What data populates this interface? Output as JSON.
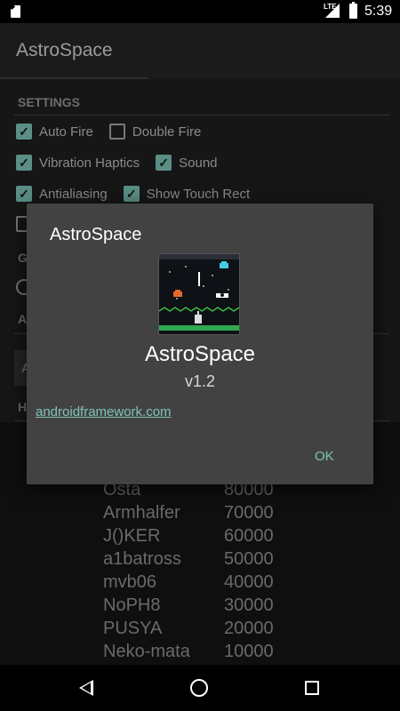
{
  "status_bar": {
    "time": "5:39",
    "network": "LTE"
  },
  "app_bar": {
    "title": "AstroSpace"
  },
  "settings": {
    "header": "SETTINGS",
    "checkboxes": [
      {
        "label": "Auto Fire",
        "checked": true
      },
      {
        "label": "Double Fire",
        "checked": false
      },
      {
        "label": "Vibration Haptics",
        "checked": true
      },
      {
        "label": "Sound",
        "checked": true
      },
      {
        "label": "Antialiasing",
        "checked": true
      },
      {
        "label": "Show Touch Rect",
        "checked": true
      }
    ],
    "partial_headers": [
      "G",
      "A",
      "H"
    ],
    "partial_input": "A"
  },
  "highscores": [
    {
      "name": "Osta",
      "score": "80000"
    },
    {
      "name": "Armhalfer",
      "score": "70000"
    },
    {
      "name": "J()KER",
      "score": "60000"
    },
    {
      "name": "a1batross",
      "score": "50000"
    },
    {
      "name": "mvb06",
      "score": "40000"
    },
    {
      "name": "NoPH8",
      "score": "30000"
    },
    {
      "name": "PUSYA",
      "score": "20000"
    },
    {
      "name": "Neko-mata",
      "score": "10000"
    }
  ],
  "dialog": {
    "title": "AstroSpace",
    "app_name": "AstroSpace",
    "version": "v1.2",
    "link": "androidframework.com",
    "ok_label": "OK"
  },
  "colors": {
    "accent": "#7fc3b8",
    "dialog_bg": "#424242",
    "checkbox_on": "#5a8f86"
  },
  "icons": [
    "sd-card-icon",
    "signal-icon",
    "battery-icon",
    "back-icon",
    "home-icon",
    "recents-icon",
    "app-icon"
  ]
}
